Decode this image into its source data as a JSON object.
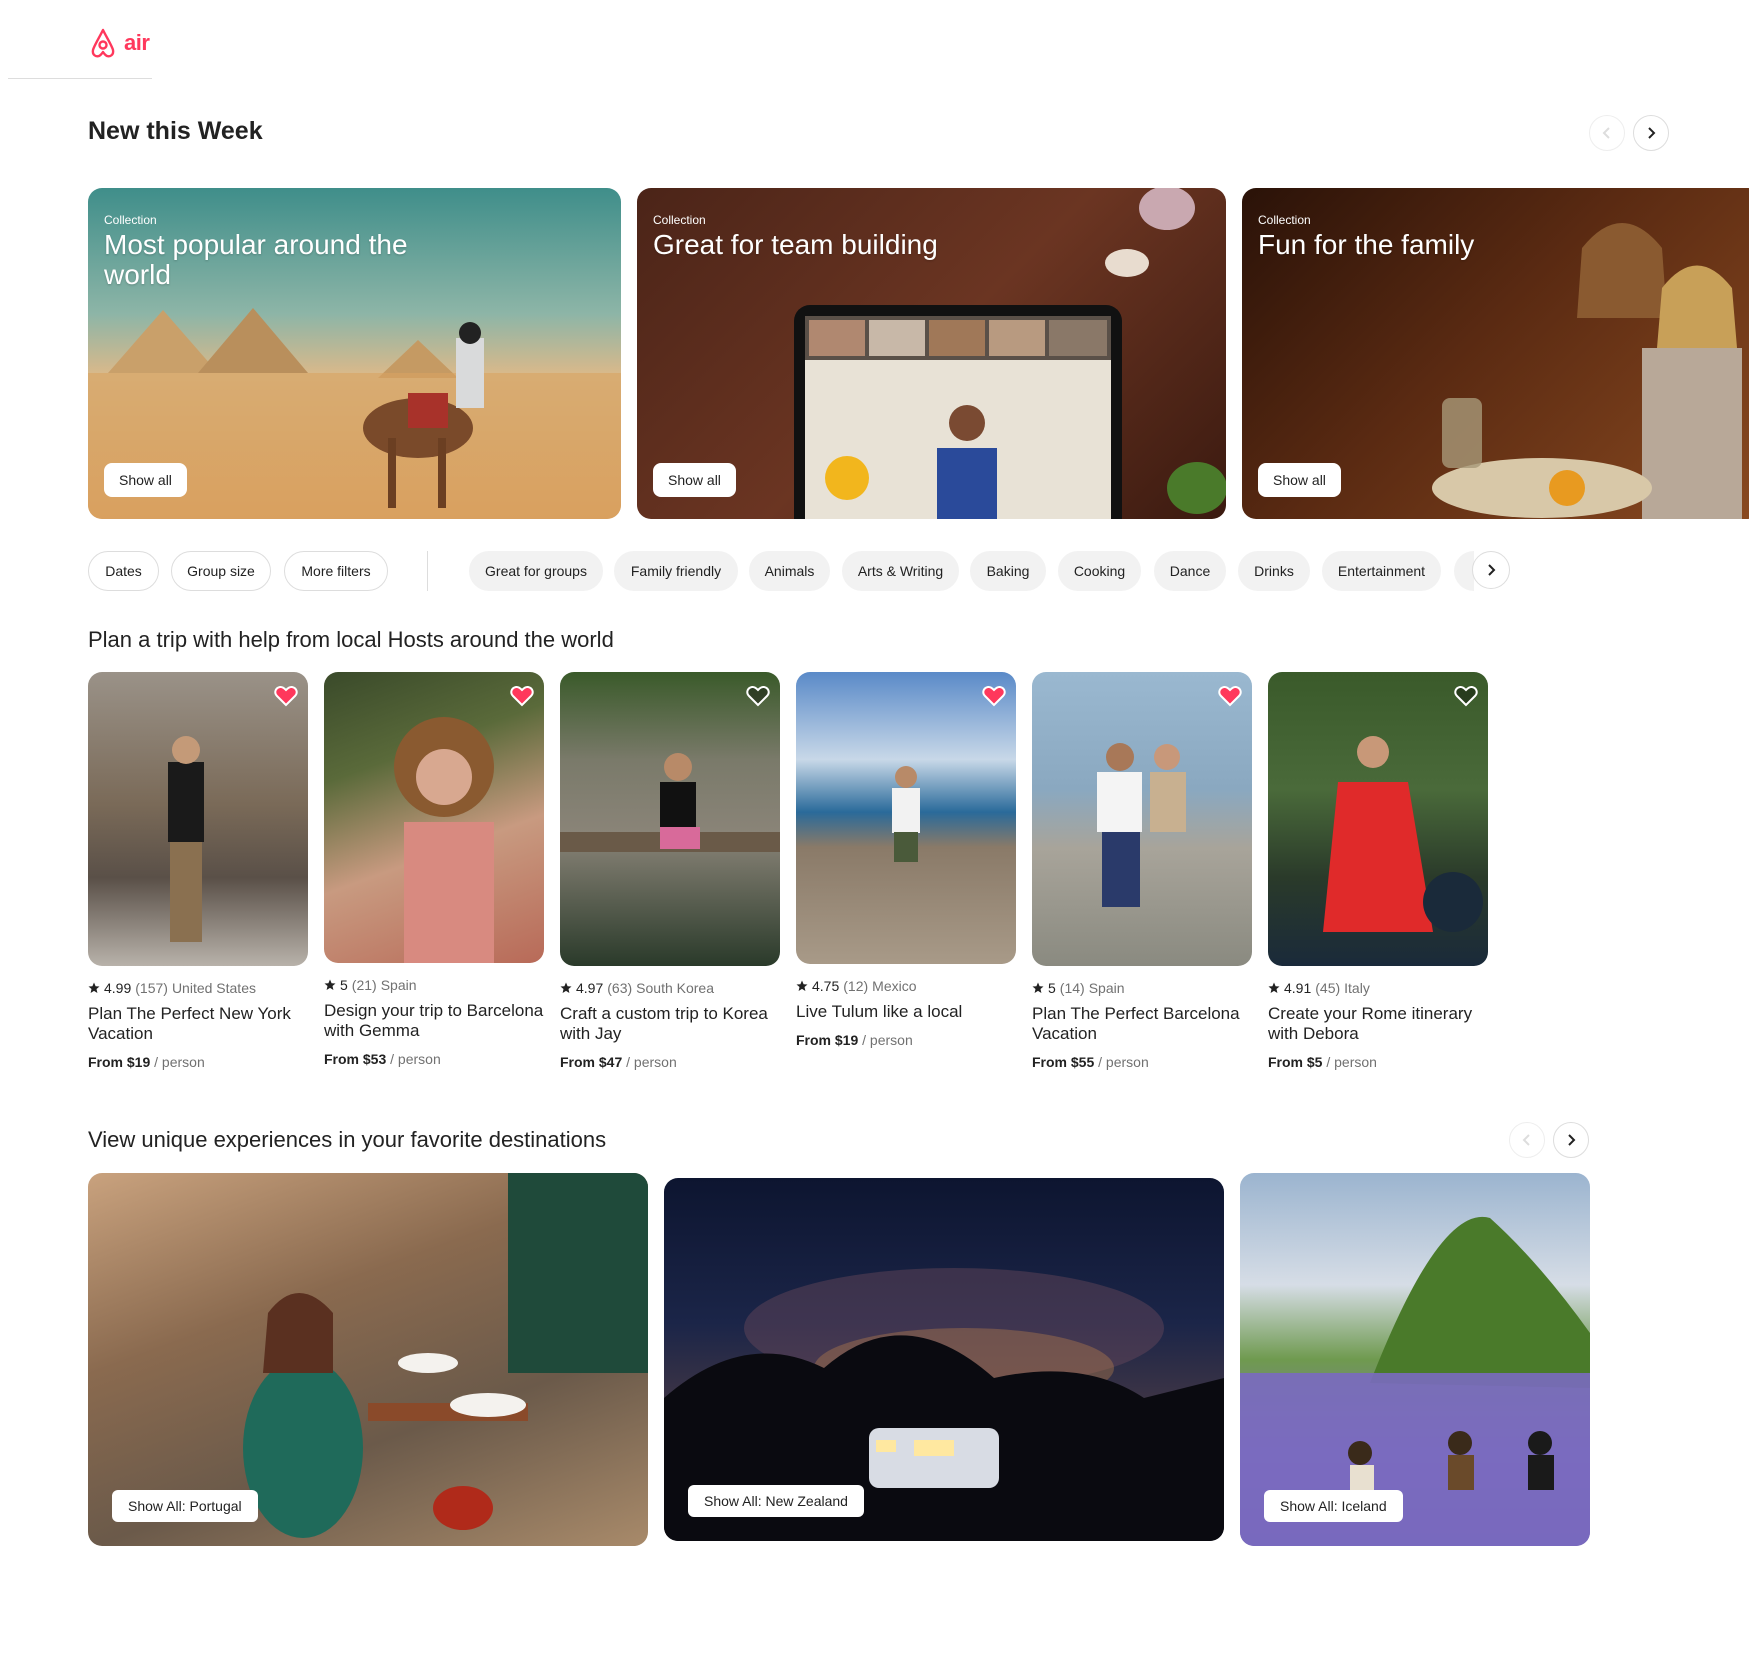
{
  "brand": {
    "logo_text": "air",
    "color": "#ff385c"
  },
  "section_new": {
    "title": "New this Week",
    "collections": [
      {
        "kicker": "Collection",
        "title": "Most popular around the world",
        "button": "Show all"
      },
      {
        "kicker": "Collection",
        "title": "Great for team building",
        "button": "Show all"
      },
      {
        "kicker": "Collection",
        "title": "Fun for the family",
        "button": "Show all"
      }
    ]
  },
  "filters": {
    "primary": [
      "Dates",
      "Group size",
      "More filters"
    ],
    "categories": [
      "Great for groups",
      "Family friendly",
      "Animals",
      "Arts & Writing",
      "Baking",
      "Cooking",
      "Dance",
      "Drinks",
      "Entertainment"
    ]
  },
  "section_plan": {
    "title": "Plan a trip with help from local Hosts around the world",
    "experiences": [
      {
        "rating": "4.99",
        "reviews": "(157)",
        "location": "United States",
        "title": "Plan The Perfect New York Vacation",
        "price_from": "From $19",
        "price_unit": "/ person",
        "saved": true
      },
      {
        "rating": "5",
        "reviews": "(21)",
        "location": "Spain",
        "title": "Design your trip to Barcelona with Gemma",
        "price_from": "From $53",
        "price_unit": "/ person",
        "saved": true
      },
      {
        "rating": "4.97",
        "reviews": "(63)",
        "location": "South Korea",
        "title": "Craft a custom trip to Korea with Jay",
        "price_from": "From $47",
        "price_unit": "/ person",
        "saved": false
      },
      {
        "rating": "4.75",
        "reviews": "(12)",
        "location": "Mexico",
        "title": "Live Tulum like a local",
        "price_from": "From $19",
        "price_unit": "/ person",
        "saved": true
      },
      {
        "rating": "5",
        "reviews": "(14)",
        "location": "Spain",
        "title": "Plan The Perfect Barcelona Vacation",
        "price_from": "From $55",
        "price_unit": "/ person",
        "saved": true
      },
      {
        "rating": "4.91",
        "reviews": "(45)",
        "location": "Italy",
        "title": "Create your Rome itinerary with Debora",
        "price_from": "From $5",
        "price_unit": "/ person",
        "saved": false
      }
    ]
  },
  "section_dest": {
    "title": "View unique experiences in your favorite destinations",
    "destinations": [
      {
        "button": "Show All: Portugal"
      },
      {
        "button": "Show All: New Zealand"
      },
      {
        "button": "Show All: Iceland"
      }
    ]
  },
  "colors": {
    "heart_saved": "#ff385c",
    "text_primary": "#222222",
    "text_secondary": "#717171",
    "border": "#dddddd"
  },
  "icons": [
    "airbnb-logo-icon",
    "chevron-left-icon",
    "chevron-right-icon",
    "heart-icon",
    "star-icon"
  ]
}
